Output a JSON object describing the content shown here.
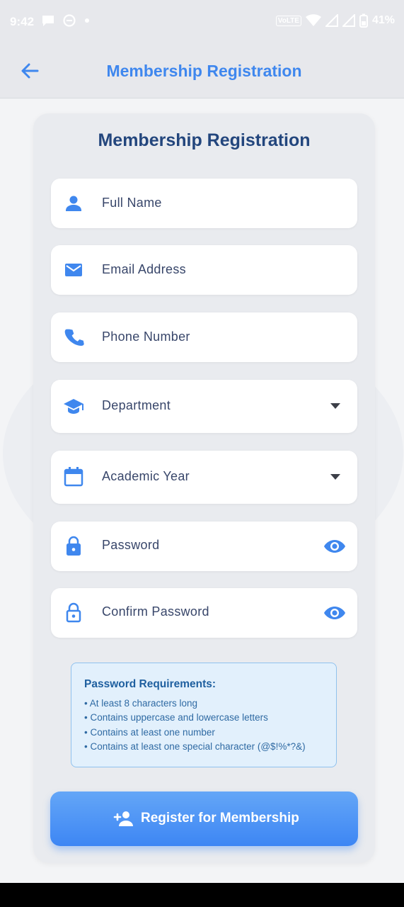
{
  "status_bar": {
    "time": "9:42",
    "battery": "41%",
    "network_badge": "VoLTE"
  },
  "app_bar": {
    "title": "Membership Registration",
    "back_icon": "arrow-back-icon"
  },
  "form": {
    "title": "Membership Registration",
    "fields": [
      {
        "label": "Full Name",
        "icon": "person-icon"
      },
      {
        "label": "Email Address",
        "icon": "email-icon"
      },
      {
        "label": "Phone Number",
        "icon": "phone-icon"
      },
      {
        "label": "Department",
        "icon": "school-icon",
        "type": "dropdown"
      },
      {
        "label": "Academic Year",
        "icon": "calendar-icon",
        "type": "dropdown"
      },
      {
        "label": "Password",
        "icon": "lock-icon",
        "type": "password"
      },
      {
        "label": "Confirm Password",
        "icon": "lock-outline-icon",
        "type": "password"
      }
    ]
  },
  "requirements": {
    "title": "Password Requirements:",
    "items": [
      "• At least 8 characters long",
      "• Contains uppercase and lowercase letters",
      "• Contains at least one number",
      "• Contains at least one special character (@$!%*?&)"
    ]
  },
  "register_button": {
    "label": "Register for Membership",
    "icon": "person-add-icon"
  },
  "colors": {
    "accent": "#3f87ee",
    "title_dark": "#23467d",
    "button_top": "#64a6f7",
    "button_bottom": "#3d86f4",
    "requirements_bg": "#e2f0fc"
  }
}
